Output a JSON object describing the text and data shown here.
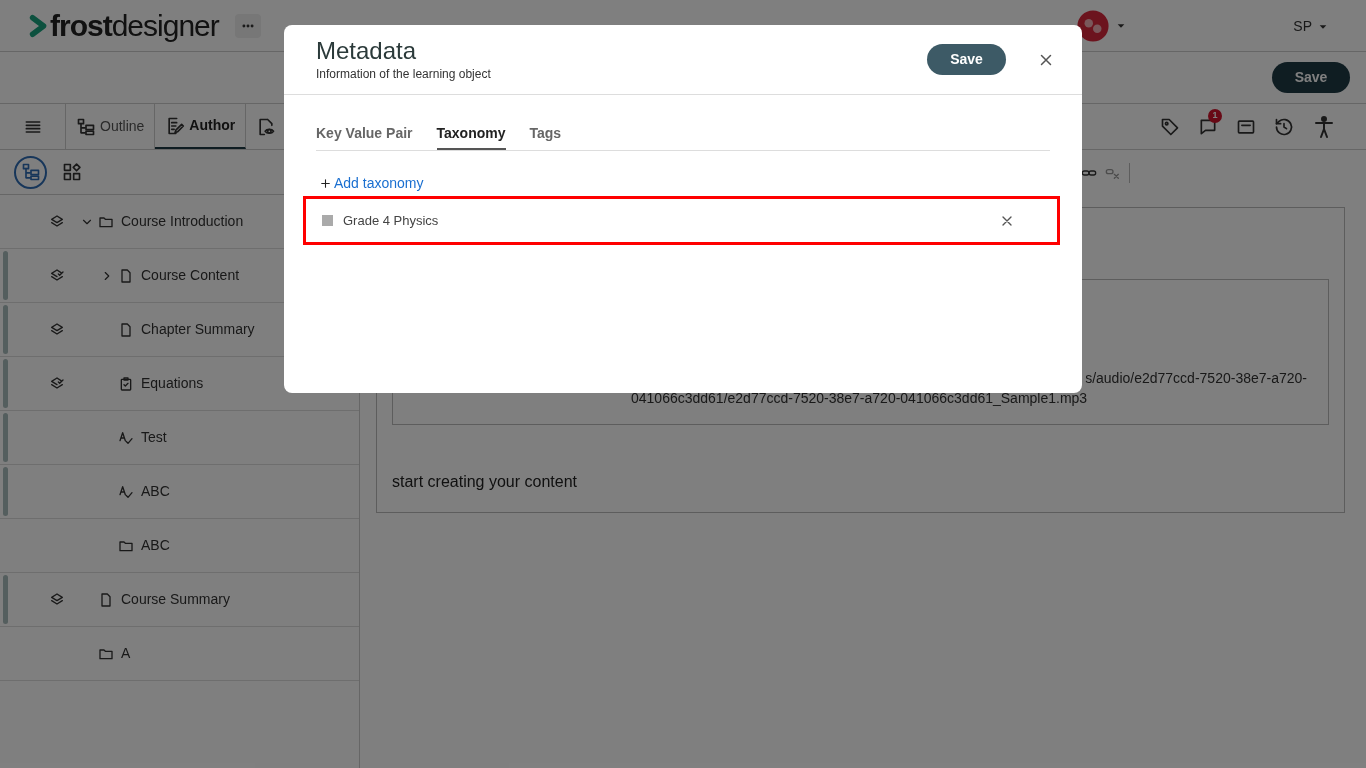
{
  "header": {
    "logo": "**frost**designer",
    "user": "SP"
  },
  "top_bar": {
    "save_button": "Save"
  },
  "toolbar": {
    "tabs": [
      {
        "kind": "outline",
        "label": "Outline",
        "selected": false
      },
      {
        "kind": "author",
        "label": "Author",
        "selected": true
      },
      {
        "kind": "preview",
        "selected": false
      }
    ],
    "comment_count": "1"
  },
  "outline": {
    "view_tabs": [
      {
        "kind": "tree",
        "selected": true
      },
      {
        "kind": "blocks",
        "selected": false
      }
    ],
    "items": [
      {
        "label": "Course Introduction",
        "kind": "folder",
        "layered": true,
        "reviewed": false,
        "flagged": false,
        "expanded": true,
        "children": [
          {
            "label": "Course Content",
            "kind": "file",
            "layered": true,
            "reviewed": true,
            "flagged": true,
            "expanded": false
          },
          {
            "label": "Chapter Summary",
            "kind": "file",
            "layered": true,
            "reviewed": false,
            "flagged": true
          },
          {
            "label": "Equations",
            "kind": "checklist",
            "layered": true,
            "reviewed": true,
            "flagged": true
          },
          {
            "label": "Test",
            "kind": "spell",
            "layered": false,
            "flagged": true
          },
          {
            "label": "ABC",
            "kind": "spell",
            "layered": false,
            "flagged": true
          },
          {
            "label": "ABC",
            "kind": "folder",
            "layered": false,
            "flagged": false
          }
        ]
      },
      {
        "label": "Course Summary",
        "kind": "file",
        "layered": true,
        "reviewed": false,
        "flagged": true
      },
      {
        "label": "A",
        "kind": "folder",
        "layered": false,
        "flagged": false
      }
    ]
  },
  "editor": {
    "audio_path_lines": [
      "s/audio/e2d77ccd-7520-38e7-a720-",
      "041066c3dd61/e2d77ccd-7520-38e7-a720-041066c3dd61_Sample1.mp3"
    ],
    "body_text": "start creating your content"
  },
  "modal": {
    "title": "Metadata",
    "subtitle": "Information of the learning object",
    "save_button": "Save",
    "tabs": [
      {
        "label": "Key Value Pair",
        "selected": false
      },
      {
        "label": "Taxonomy",
        "selected": true
      },
      {
        "label": "Tags",
        "selected": false
      }
    ],
    "add_link": "Add taxonomy",
    "taxonomies": [
      {
        "label": "Grade 4 Physics",
        "highlighted": true
      }
    ]
  }
}
